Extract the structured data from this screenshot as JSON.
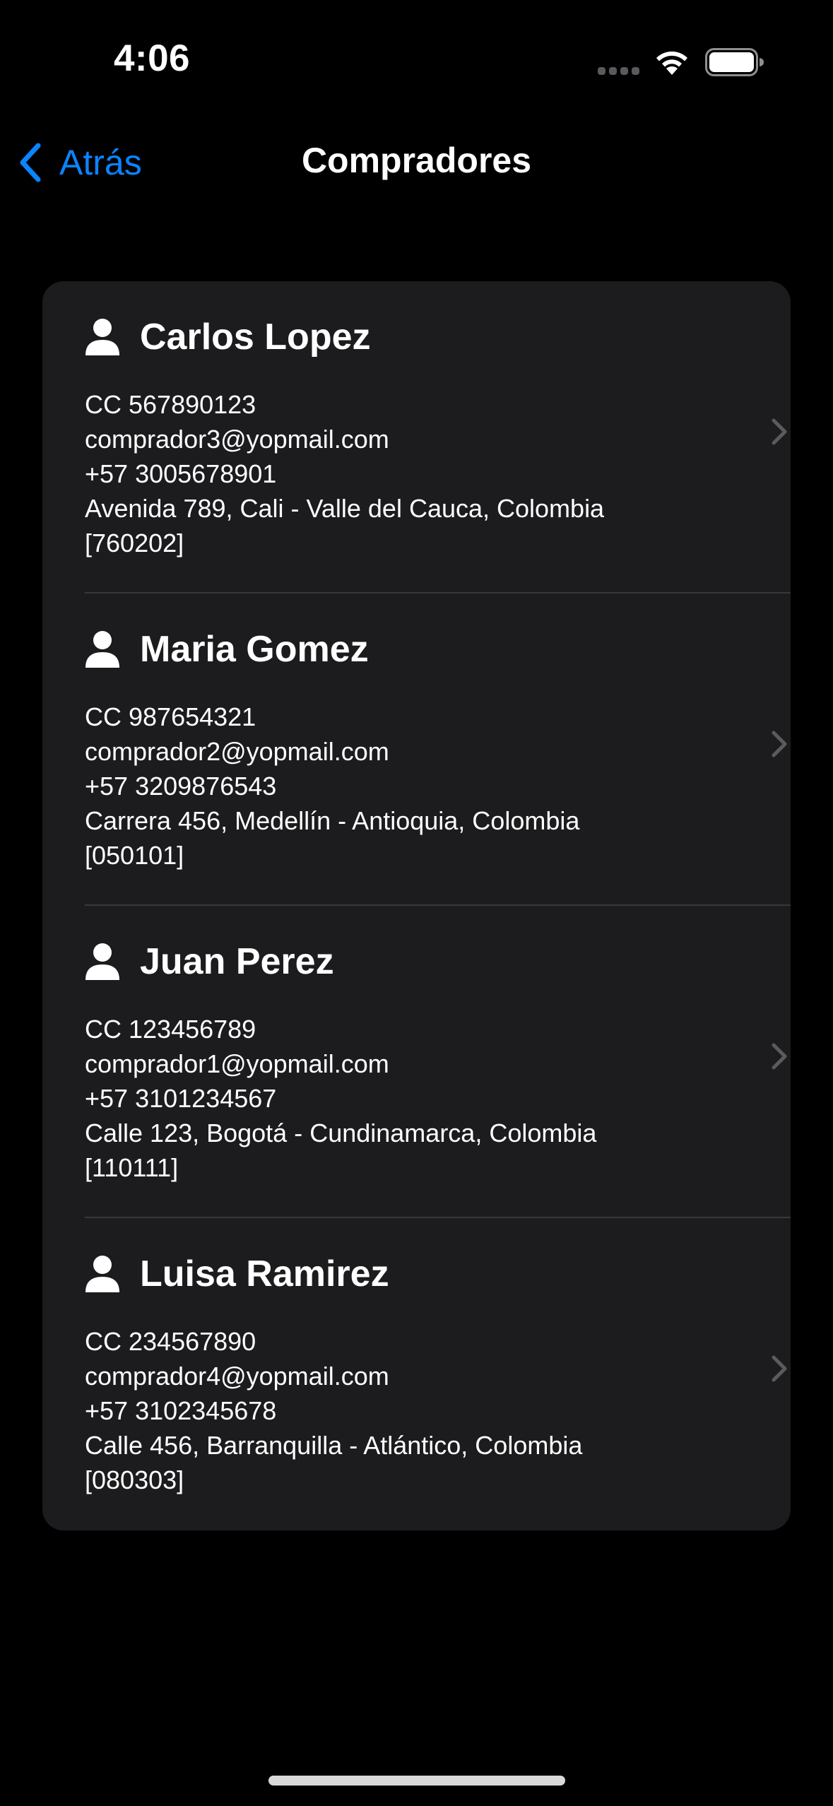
{
  "status_bar": {
    "time": "4:06"
  },
  "nav": {
    "back_label": "Atrás",
    "title": "Compradores"
  },
  "colors": {
    "accent": "#0a84ff",
    "background": "#000000",
    "card": "#1c1c1e",
    "chevron": "#5b5b5f"
  },
  "buyers": [
    {
      "name": "Carlos Lopez",
      "document": "CC 567890123",
      "email": "comprador3@yopmail.com",
      "phone": "+57 3005678901",
      "address": "Avenida 789, Cali - Valle del Cauca, Colombia",
      "postal_code": "[760202]"
    },
    {
      "name": "Maria Gomez",
      "document": "CC 987654321",
      "email": "comprador2@yopmail.com",
      "phone": "+57 3209876543",
      "address": "Carrera 456, Medellín - Antioquia, Colombia",
      "postal_code": "[050101]"
    },
    {
      "name": "Juan Perez",
      "document": "CC 123456789",
      "email": "comprador1@yopmail.com",
      "phone": "+57 3101234567",
      "address": "Calle 123, Bogotá - Cundinamarca, Colombia",
      "postal_code": "[110111]"
    },
    {
      "name": "Luisa Ramirez",
      "document": "CC 234567890",
      "email": "comprador4@yopmail.com",
      "phone": "+57 3102345678",
      "address": "Calle 456, Barranquilla - Atlántico, Colombia",
      "postal_code": "[080303]"
    }
  ]
}
